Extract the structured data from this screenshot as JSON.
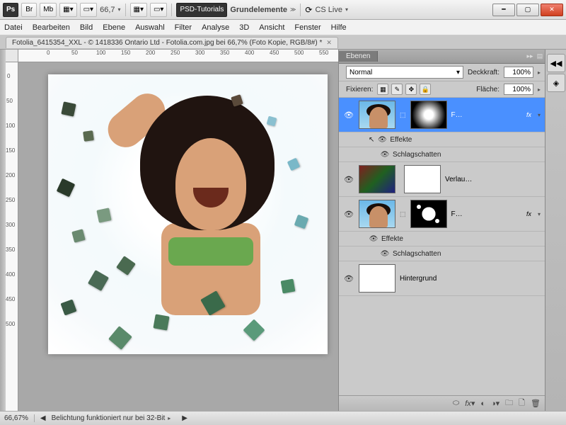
{
  "toolbar": {
    "app_icon": "Ps",
    "buttons": [
      "Br",
      "Mb"
    ],
    "zoom": "66,7",
    "psd_tutorials": "PSD-Tutorials",
    "grundelemente": "Grundelemente",
    "cslive": "CS Live"
  },
  "menu": [
    "Datei",
    "Bearbeiten",
    "Bild",
    "Ebene",
    "Auswahl",
    "Filter",
    "Analyse",
    "3D",
    "Ansicht",
    "Fenster",
    "Hilfe"
  ],
  "doc": {
    "title": "Fotolia_6415354_XXL - © 1418336 Ontario Ltd - Fotolia.com.jpg bei 66,7% (Foto Kopie, RGB/8#) *"
  },
  "ruler_h": [
    "0",
    "50",
    "100",
    "150",
    "200",
    "250",
    "300",
    "350",
    "400",
    "450",
    "500",
    "550"
  ],
  "ruler_v": [
    "0",
    "50",
    "100",
    "150",
    "200",
    "250",
    "300",
    "350",
    "400",
    "450",
    "500"
  ],
  "panel": {
    "tab": "Ebenen",
    "blend_mode": "Normal",
    "opacity_label": "Deckkraft:",
    "opacity_value": "100%",
    "lock_label": "Fixieren:",
    "fill_label": "Fläche:",
    "fill_value": "100%"
  },
  "layers": [
    {
      "name": "F…",
      "fx": "fx",
      "effects_label": "Effekte",
      "effect1": "Schlagschatten"
    },
    {
      "name": "Verlau…"
    },
    {
      "name": "F…",
      "fx": "fx",
      "effects_label": "Effekte",
      "effect1": "Schlagschatten"
    },
    {
      "name": "Hintergrund"
    }
  ],
  "status": {
    "zoom": "66,67%",
    "msg": "Belichtung funktioniert nur bei 32-Bit"
  }
}
